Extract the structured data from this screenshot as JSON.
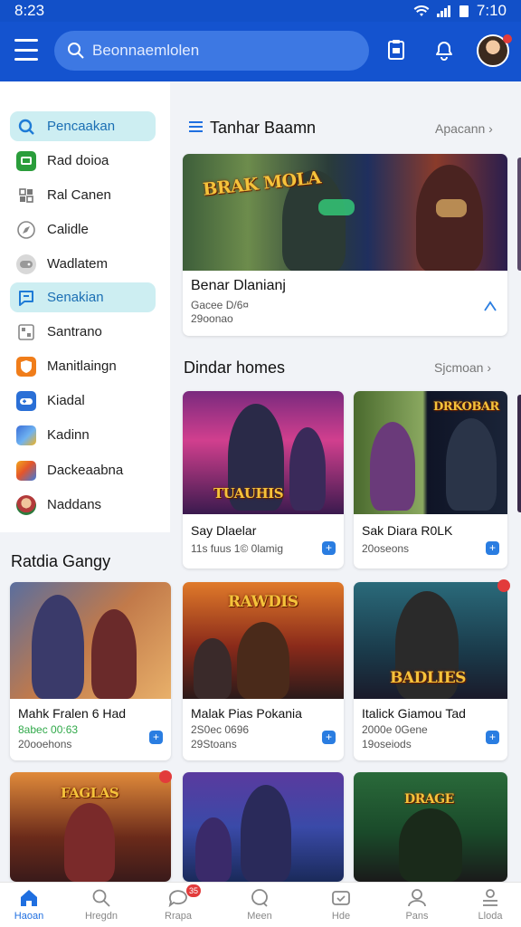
{
  "status": {
    "time": "8:23",
    "clock": "7:10"
  },
  "appbar": {
    "search_placeholder": "Beonnaemlolen"
  },
  "sidebar": {
    "items": [
      {
        "label": "Pencaakan",
        "icon": "search-icon",
        "color": "#1e7bd6",
        "active": true
      },
      {
        "label": "Rad doioa",
        "icon": "tv-icon",
        "color": "#2a9d3b",
        "active": false
      },
      {
        "label": "Ral Canen",
        "icon": "puzzle-icon",
        "color": "#777777",
        "active": false
      },
      {
        "label": "Calidle",
        "icon": "compass-icon",
        "color": "#888888",
        "active": false
      },
      {
        "label": "Wadlatem",
        "icon": "gamepad-icon",
        "color": "#999999",
        "active": false
      },
      {
        "label": "Senakian",
        "icon": "chat-icon",
        "color": "#1e7bd6",
        "active": true
      },
      {
        "label": "Santrano",
        "icon": "grid-icon",
        "color": "#888888",
        "active": false
      },
      {
        "label": "Manitlaingn",
        "icon": "shield-icon",
        "color": "#f07d1a",
        "active": false
      },
      {
        "label": "Kiadal",
        "icon": "controller-icon",
        "color": "#2a6fd6",
        "active": false
      },
      {
        "label": "Kadinn",
        "icon": "game-tile-icon",
        "color": "#3b6ed8",
        "active": false
      },
      {
        "label": "Dackeaabna",
        "icon": "colorful-tile-icon",
        "color": "#f2a81c",
        "active": false
      },
      {
        "label": "Naddans",
        "icon": "avatar-icon",
        "color": "#b23a3a",
        "active": false
      }
    ],
    "section_label": "Ratdia Gangy"
  },
  "featured": {
    "title": "Tanhar Baamn",
    "see_all": "Apacann",
    "card": {
      "logo": "BRAK MOLA",
      "title": "Benar Dlanianj",
      "line1": "Gacee D/6¤",
      "line2": "29oonao"
    }
  },
  "section2": {
    "title": "Dindar homes",
    "see_all": "Sjcmoan"
  },
  "cards_row1": [
    {
      "logo": "TUAUHIS",
      "title": "Say Dlaelar",
      "line1": "11s fuus 1© 0lamig",
      "line2": ""
    },
    {
      "logo": "DRKOBAR",
      "title": "Sak Diara R0LK",
      "line1": "20oseons",
      "line2": ""
    }
  ],
  "cards_row2": [
    {
      "logo": "",
      "title": "Mahk Fralen 6 Had",
      "line1": "8abec 00:63",
      "line2": "20ooehons"
    },
    {
      "logo": "RAWDIS",
      "title": "Malak Pias Pokania",
      "line1": "2S0ec 0696",
      "line2": "29Stoans"
    },
    {
      "logo": "BADLIES",
      "title": "Italick Giamou Tad",
      "line1": "2000e 0Gene",
      "line2": "19oseiods"
    }
  ],
  "cards_row3": [
    {
      "logo": "FAGLAS"
    },
    {
      "logo": ""
    },
    {
      "logo": "DRAGE"
    }
  ],
  "bottom_nav": [
    {
      "label": "Haoan",
      "icon": "home-icon",
      "active": true
    },
    {
      "label": "Hregdn",
      "icon": "search-icon",
      "active": false
    },
    {
      "label": "Rrapa",
      "icon": "chat-icon",
      "active": false,
      "badge": "35"
    },
    {
      "label": "Meen",
      "icon": "magnify-chat-icon",
      "active": false
    },
    {
      "label": "Hde",
      "icon": "tv-icon",
      "active": false
    },
    {
      "label": "Pans",
      "icon": "profile-icon",
      "active": false
    },
    {
      "label": "Lloda",
      "icon": "menu-stack-icon",
      "active": false
    }
  ],
  "colors": {
    "brand": "#1453cf",
    "accent": "#1f6fe0",
    "active_bg": "#cdeef2"
  }
}
